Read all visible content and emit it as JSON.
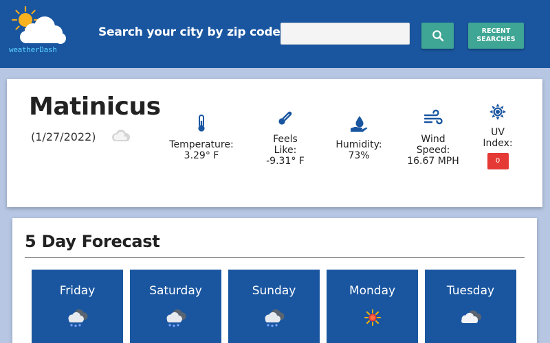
{
  "header": {
    "logo_text": "weatherDash",
    "search_label": "Search your city by zip code:",
    "search_value": "",
    "search_icon": "search-icon",
    "recent_label": "RECENT SEARCHES"
  },
  "current": {
    "city": "Matinicus",
    "date": "(1/27/2022)",
    "condition_icon": "cloud-icon",
    "temperature": {
      "label": "Temperature:",
      "value": "3.29° F",
      "icon": "thermometer-icon"
    },
    "feels_like": {
      "label_1": "Feels",
      "label_2": "Like:",
      "value": "-9.31° F",
      "icon": "temperature-pen-icon"
    },
    "humidity": {
      "label": "Humidity:",
      "value": "73%",
      "icon": "water-drop-hand-icon"
    },
    "wind": {
      "label_1": "Wind",
      "label_2": "Speed:",
      "value": "16.67 MPH",
      "icon": "wind-icon"
    },
    "uv": {
      "label_1": "UV",
      "label_2": "Index:",
      "value": "0",
      "icon": "sun-icon",
      "badge_color": "#e53935"
    }
  },
  "forecast": {
    "title": "5 Day Forecast",
    "days": [
      {
        "name": "Friday",
        "icon": "snow-cloud-icon"
      },
      {
        "name": "Saturday",
        "icon": "snow-cloud-icon"
      },
      {
        "name": "Sunday",
        "icon": "snow-cloud-icon"
      },
      {
        "name": "Monday",
        "icon": "sun-icon"
      },
      {
        "name": "Tuesday",
        "icon": "cloud-icon"
      }
    ]
  },
  "colors": {
    "header_bg": "#1a56a0",
    "page_bg": "#b6c6e3",
    "accent_button": "#3fa594",
    "forecast_card_bg": "#1a56a0",
    "icon_blue": "#1a56a0"
  }
}
